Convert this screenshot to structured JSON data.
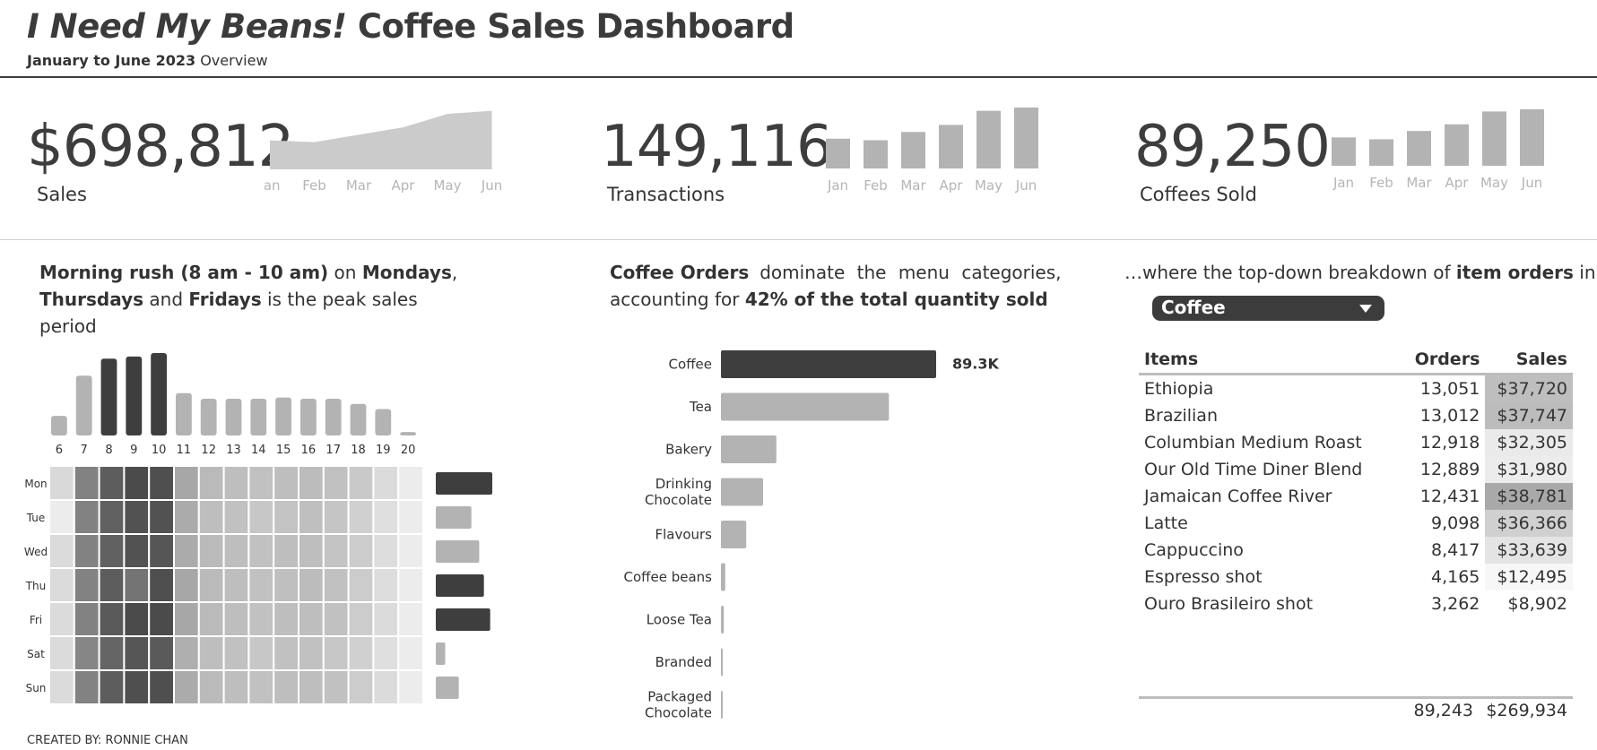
{
  "header": {
    "title_italic": "I Need My Beans!",
    "title_rest": " Coffee Sales Dashboard",
    "subtitle_bold": "January to June 2023",
    "subtitle_rest": " Overview"
  },
  "kpis": [
    {
      "value": "$698,812",
      "label": "Sales"
    },
    {
      "value": "149,116",
      "label": "Transactions"
    },
    {
      "value": "89,250",
      "label": "Coffees Sold"
    }
  ],
  "headlines": {
    "h1": {
      "p1": "Morning rush (8 am - 10 am)",
      "p2": " on ",
      "p3": "Mondays",
      "p4": ",",
      "p5": "Thursdays",
      "p6": " and ",
      "p7": "Fridays",
      "p8": " is the peak sales period"
    },
    "h2": {
      "p1": "Coffee Orders",
      "p2": " dominate the menu categories,",
      "p3": "accounting for ",
      "p4": "42% of the total quantity sold"
    },
    "h3": {
      "p1": "…where the top-down breakdown of ",
      "p2": "item orders",
      "p3": " in"
    }
  },
  "filter": {
    "selected": "Coffee"
  },
  "items_table": {
    "headers": [
      "Items",
      "Orders",
      "Sales"
    ],
    "rows": [
      {
        "item": "Ethiopia",
        "orders": "13,051",
        "sales": "$37,720",
        "shade": "#bebebe"
      },
      {
        "item": "Brazilian",
        "orders": "13,012",
        "sales": "$37,747",
        "shade": "#bcbcbc"
      },
      {
        "item": "Columbian Medium Roast",
        "orders": "12,918",
        "sales": "$32,305",
        "shade": "#eaeaea"
      },
      {
        "item": "Our Old Time Diner Blend",
        "orders": "12,889",
        "sales": "$31,980",
        "shade": "#ececec"
      },
      {
        "item": "Jamaican Coffee River",
        "orders": "12,431",
        "sales": "$38,781",
        "shade": "#a9a9a9"
      },
      {
        "item": "Latte",
        "orders": "9,098",
        "sales": "$36,366",
        "shade": "#d0d0d0"
      },
      {
        "item": "Cappuccino",
        "orders": "8,417",
        "sales": "$33,639",
        "shade": "#e4e4e4"
      },
      {
        "item": "Espresso shot",
        "orders": "4,165",
        "sales": "$12,495",
        "shade": "#f7f7f7"
      },
      {
        "item": "Ouro Brasileiro shot",
        "orders": "3,262",
        "sales": "$8,902",
        "shade": "#ffffff"
      }
    ],
    "totals": {
      "orders": "89,243",
      "sales": "$269,934"
    }
  },
  "credit": "CREATED BY: RONNIE CHAN",
  "chart_data": [
    {
      "id": "sales_trend",
      "type": "area",
      "categories": [
        "Jan",
        "Feb",
        "Mar",
        "Apr",
        "May",
        "Jun"
      ],
      "values": [
        82000,
        77000,
        98000,
        119000,
        157000,
        166000
      ],
      "title": "",
      "xlabel": "",
      "ylabel": ""
    },
    {
      "id": "transactions_trend",
      "type": "bar",
      "categories": [
        "Jan",
        "Feb",
        "Mar",
        "Apr",
        "May",
        "Jun"
      ],
      "values": [
        17300,
        16400,
        21200,
        25300,
        33500,
        35400
      ],
      "title": "",
      "xlabel": "",
      "ylabel": ""
    },
    {
      "id": "coffees_trend",
      "type": "bar",
      "categories": [
        "Jan",
        "Feb",
        "Mar",
        "Apr",
        "May",
        "Jun"
      ],
      "values": [
        10600,
        9900,
        13000,
        15500,
        20300,
        21100
      ],
      "title": "",
      "xlabel": "",
      "ylabel": ""
    },
    {
      "id": "hourly_orders",
      "type": "bar",
      "categories": [
        "6",
        "7",
        "8",
        "9",
        "10",
        "11",
        "12",
        "13",
        "14",
        "15",
        "16",
        "17",
        "18",
        "19",
        "20"
      ],
      "values": [
        4600,
        14000,
        18000,
        18500,
        19300,
        9900,
        8600,
        8600,
        8600,
        8900,
        8600,
        8600,
        7400,
        6200,
        800
      ],
      "peak": [
        "8",
        "9",
        "10"
      ],
      "title": "",
      "xlabel": "",
      "ylabel": ""
    },
    {
      "id": "weekday_hour_heatmap",
      "type": "heatmap",
      "rows": [
        "Mon",
        "Tue",
        "Wed",
        "Thu",
        "Fri",
        "Sat",
        "Sun"
      ],
      "columns": [
        "6",
        "7",
        "8",
        "9",
        "10",
        "11",
        "12",
        "13",
        "14",
        "15",
        "16",
        "17",
        "18",
        "19",
        "20"
      ],
      "values": [
        [
          0.15,
          0.62,
          0.82,
          0.92,
          0.9,
          0.42,
          0.32,
          0.3,
          0.28,
          0.3,
          0.31,
          0.28,
          0.24,
          0.14,
          0.05
        ],
        [
          0.05,
          0.62,
          0.8,
          0.88,
          0.88,
          0.4,
          0.3,
          0.28,
          0.25,
          0.27,
          0.29,
          0.26,
          0.2,
          0.12,
          0.05
        ],
        [
          0.14,
          0.62,
          0.8,
          0.88,
          0.86,
          0.4,
          0.32,
          0.3,
          0.28,
          0.3,
          0.3,
          0.27,
          0.22,
          0.13,
          0.05
        ],
        [
          0.14,
          0.62,
          0.82,
          0.7,
          0.9,
          0.42,
          0.32,
          0.3,
          0.28,
          0.29,
          0.31,
          0.28,
          0.22,
          0.13,
          0.05
        ],
        [
          0.14,
          0.62,
          0.84,
          0.92,
          0.92,
          0.42,
          0.32,
          0.3,
          0.28,
          0.3,
          0.3,
          0.28,
          0.22,
          0.14,
          0.05
        ],
        [
          0.14,
          0.6,
          0.78,
          0.86,
          0.84,
          0.38,
          0.3,
          0.28,
          0.25,
          0.28,
          0.28,
          0.25,
          0.2,
          0.12,
          0.05
        ],
        [
          0.14,
          0.62,
          0.82,
          0.9,
          0.9,
          0.4,
          0.32,
          0.3,
          0.28,
          0.3,
          0.3,
          0.28,
          0.22,
          0.14,
          0.05
        ]
      ],
      "title": "",
      "xlabel": "",
      "ylabel": ""
    },
    {
      "id": "weekday_orders",
      "type": "bar",
      "orientation": "horizontal",
      "categories": [
        "Mon",
        "Tue",
        "Wed",
        "Thu",
        "Fri",
        "Sat",
        "Sun"
      ],
      "values": [
        21600,
        13600,
        16600,
        18400,
        20800,
        3600,
        8800
      ],
      "peak": [
        "Mon",
        "Thu",
        "Fri"
      ],
      "title": "",
      "xlabel": "",
      "ylabel": ""
    },
    {
      "id": "category_quantity",
      "type": "bar",
      "orientation": "horizontal",
      "categories": [
        "Coffee",
        "Tea",
        "Bakery",
        "Drinking Chocolate",
        "Flavours",
        "Coffee beans",
        "Loose Tea",
        "Branded",
        "Packaged Chocolate"
      ],
      "values": [
        89300,
        69700,
        23000,
        17500,
        10500,
        1800,
        1200,
        780,
        490
      ],
      "data_labels": [
        "89.3K",
        "",
        "",
        "",
        "",
        "",
        "",
        "",
        ""
      ],
      "highlight": "Coffee",
      "title": "",
      "xlabel": "",
      "ylabel": ""
    }
  ]
}
